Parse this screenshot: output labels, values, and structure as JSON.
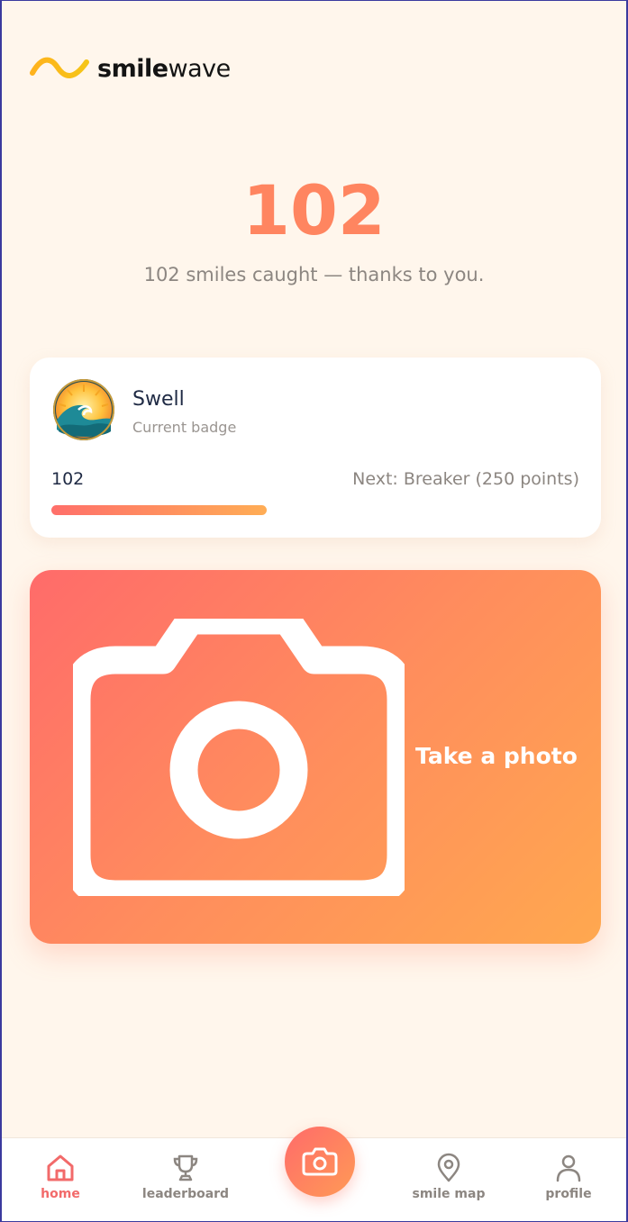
{
  "brand": {
    "name_bold": "smile",
    "name_light": "wave"
  },
  "hero": {
    "count": "102",
    "subtitle": "102 smiles caught — thanks to you."
  },
  "badge": {
    "name": "Swell",
    "caption": "Current badge",
    "points": "102",
    "next": "Next: Breaker (250 points)",
    "progress_fraction": 0.408
  },
  "cta": {
    "label": "Take a photo",
    "icon": "camera-icon"
  },
  "nav": {
    "items": [
      {
        "label": "home",
        "icon": "home-icon",
        "active": true
      },
      {
        "label": "leaderboard",
        "icon": "trophy-icon",
        "active": false
      },
      {
        "label": "",
        "icon": "camera-icon",
        "active": false
      },
      {
        "label": "smile map",
        "icon": "map-pin-icon",
        "active": false
      },
      {
        "label": "profile",
        "icon": "user-icon",
        "active": false
      }
    ]
  },
  "colors": {
    "background": "#fff6ec",
    "accent": "#ff8560",
    "gradient_start": "#ff6b6a",
    "gradient_end": "#ffa84f",
    "active_nav": "#f26a6a"
  }
}
